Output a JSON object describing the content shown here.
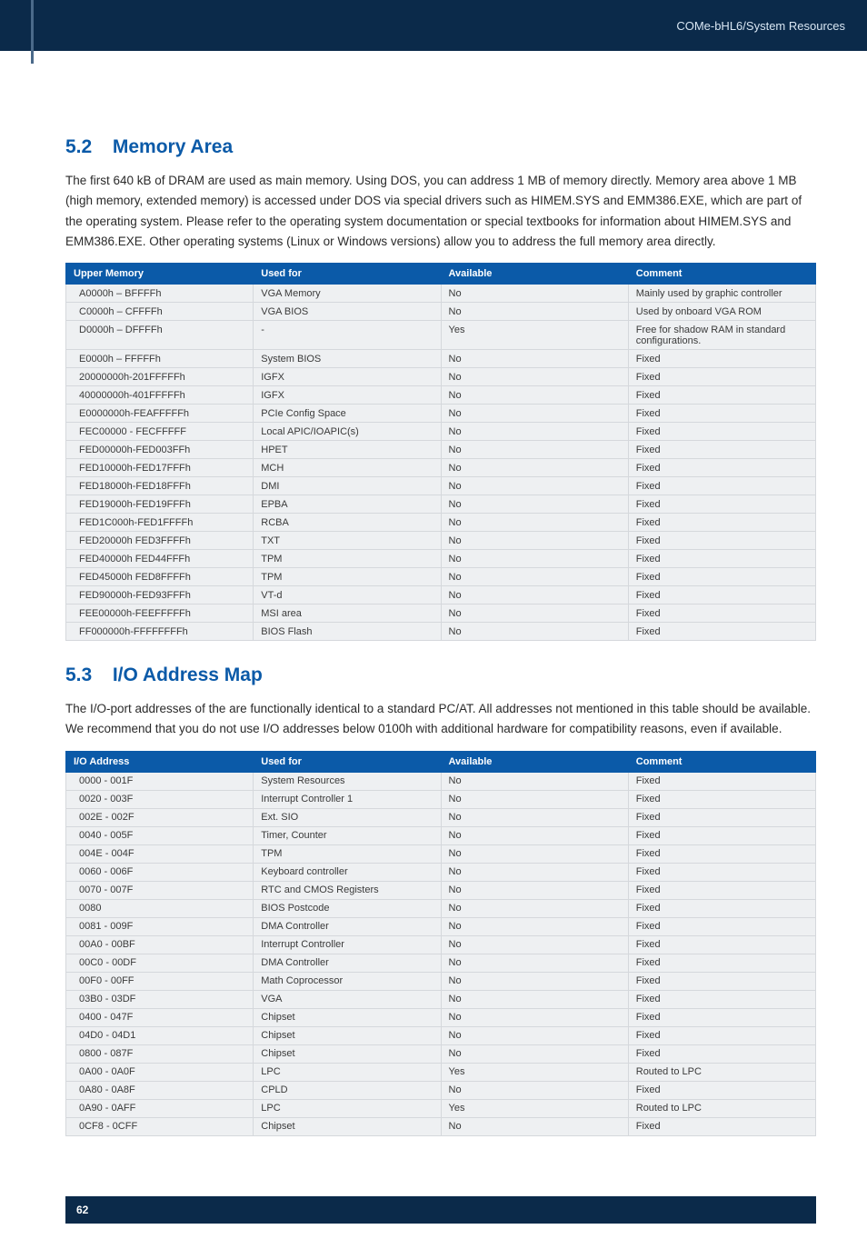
{
  "header": {
    "product": "COMe-bHL6",
    "separator": " / ",
    "section": "System Resources"
  },
  "section52": {
    "number": "5.2",
    "title": "Memory Area",
    "paragraph": "The first 640 kB of DRAM are used as main memory. Using DOS, you can address 1 MB of memory directly. Memory area above 1 MB (high memory, extended memory) is accessed under DOS via special drivers such as HIMEM.SYS and EMM386.EXE, which are part of the operating system. Please refer to the operating system documentation or special textbooks for information about HIMEM.SYS and EMM386.EXE. Other operating systems (Linux or Windows versions) allow you to address the full memory area directly.",
    "table": {
      "headers": [
        "Upper Memory",
        "Used for",
        "Available",
        "Comment"
      ],
      "rows": [
        [
          "A0000h – BFFFFh",
          "VGA Memory",
          "No",
          "Mainly used by graphic controller"
        ],
        [
          "C0000h – CFFFFh",
          "VGA BIOS",
          "No",
          "Used by onboard VGA ROM"
        ],
        [
          "D0000h – DFFFFh",
          "-",
          "Yes",
          "Free for shadow RAM in standard configurations."
        ],
        [
          "E0000h – FFFFFh",
          "System BIOS",
          "No",
          "Fixed"
        ],
        [
          "20000000h-201FFFFFh",
          "IGFX",
          "No",
          "Fixed"
        ],
        [
          "40000000h-401FFFFFh",
          "IGFX",
          "No",
          "Fixed"
        ],
        [
          "E0000000h-FEAFFFFFh",
          "PCIe Config Space",
          "No",
          "Fixed"
        ],
        [
          "FEC00000 - FECFFFFF",
          "Local APIC/IOAPIC(s)",
          "No",
          "Fixed"
        ],
        [
          "FED00000h-FED003FFh",
          "HPET",
          "No",
          "Fixed"
        ],
        [
          "FED10000h-FED17FFFh",
          "MCH",
          "No",
          "Fixed"
        ],
        [
          "FED18000h-FED18FFFh",
          "DMI",
          "No",
          "Fixed"
        ],
        [
          "FED19000h-FED19FFFh",
          "EPBA",
          "No",
          "Fixed"
        ],
        [
          "FED1C000h-FED1FFFFh",
          "RCBA",
          "No",
          "Fixed"
        ],
        [
          "FED20000h FED3FFFFh",
          "TXT",
          "No",
          "Fixed"
        ],
        [
          "FED40000h FED44FFFh",
          "TPM",
          "No",
          "Fixed"
        ],
        [
          "FED45000h FED8FFFFh",
          "TPM",
          "No",
          "Fixed"
        ],
        [
          "FED90000h-FED93FFFh",
          "VT-d",
          "No",
          "Fixed"
        ],
        [
          "FEE00000h-FEEFFFFFh",
          "MSI area",
          "No",
          "Fixed"
        ],
        [
          "FF000000h-FFFFFFFFh",
          "BIOS Flash",
          "No",
          "Fixed"
        ]
      ]
    }
  },
  "section53": {
    "number": "5.3",
    "title": "I/O Address Map",
    "paragraph": "The I/O-port addresses of the are functionally identical to a standard PC/AT. All addresses not mentioned in this table should be available. We recommend that you do not use I/O addresses below 0100h with additional hardware for compatibility reasons, even if available.",
    "table": {
      "headers": [
        "I/O Address",
        "Used for",
        "Available",
        "Comment"
      ],
      "rows": [
        [
          "0000 - 001F",
          "System Resources",
          "No",
          "Fixed"
        ],
        [
          "0020 - 003F",
          "Interrupt Controller 1",
          "No",
          "Fixed"
        ],
        [
          "002E - 002F",
          "Ext. SIO",
          "No",
          "Fixed"
        ],
        [
          "0040 - 005F",
          "Timer, Counter",
          "No",
          "Fixed"
        ],
        [
          "004E - 004F",
          "TPM",
          "No",
          "Fixed"
        ],
        [
          "0060 - 006F",
          "Keyboard controller",
          "No",
          "Fixed"
        ],
        [
          "0070 - 007F",
          "RTC and CMOS Registers",
          "No",
          "Fixed"
        ],
        [
          "0080",
          "BIOS Postcode",
          "No",
          "Fixed"
        ],
        [
          "0081 - 009F",
          "DMA Controller",
          "No",
          "Fixed"
        ],
        [
          "00A0 - 00BF",
          "Interrupt Controller",
          "No",
          "Fixed"
        ],
        [
          "00C0 - 00DF",
          "DMA Controller",
          "No",
          "Fixed"
        ],
        [
          "00F0 - 00FF",
          "Math Coprocessor",
          "No",
          "Fixed"
        ],
        [
          "03B0 - 03DF",
          "VGA",
          "No",
          "Fixed"
        ],
        [
          "0400 - 047F",
          "Chipset",
          "No",
          "Fixed"
        ],
        [
          "04D0 - 04D1",
          "Chipset",
          "No",
          "Fixed"
        ],
        [
          "0800 - 087F",
          "Chipset",
          "No",
          "Fixed"
        ],
        [
          "0A00 - 0A0F",
          "LPC",
          "Yes",
          "Routed to LPC"
        ],
        [
          "0A80 - 0A8F",
          "CPLD",
          "No",
          "Fixed"
        ],
        [
          "0A90 - 0AFF",
          "LPC",
          "Yes",
          "Routed to LPC"
        ],
        [
          "0CF8 - 0CFF",
          "Chipset",
          "No",
          "Fixed"
        ]
      ]
    }
  },
  "footer": {
    "page_number": "62"
  },
  "chart_data": [
    {
      "type": "table",
      "title": "Upper Memory Map",
      "columns": [
        "Upper Memory",
        "Used for",
        "Available",
        "Comment"
      ],
      "rows": [
        [
          "A0000h – BFFFFh",
          "VGA Memory",
          "No",
          "Mainly used by graphic controller"
        ],
        [
          "C0000h – CFFFFh",
          "VGA BIOS",
          "No",
          "Used by onboard VGA ROM"
        ],
        [
          "D0000h – DFFFFh",
          "-",
          "Yes",
          "Free for shadow RAM in standard configurations."
        ],
        [
          "E0000h – FFFFFh",
          "System BIOS",
          "No",
          "Fixed"
        ],
        [
          "20000000h-201FFFFFh",
          "IGFX",
          "No",
          "Fixed"
        ],
        [
          "40000000h-401FFFFFh",
          "IGFX",
          "No",
          "Fixed"
        ],
        [
          "E0000000h-FEAFFFFFh",
          "PCIe Config Space",
          "No",
          "Fixed"
        ],
        [
          "FEC00000 - FECFFFFF",
          "Local APIC/IOAPIC(s)",
          "No",
          "Fixed"
        ],
        [
          "FED00000h-FED003FFh",
          "HPET",
          "No",
          "Fixed"
        ],
        [
          "FED10000h-FED17FFFh",
          "MCH",
          "No",
          "Fixed"
        ],
        [
          "FED18000h-FED18FFFh",
          "DMI",
          "No",
          "Fixed"
        ],
        [
          "FED19000h-FED19FFFh",
          "EPBA",
          "No",
          "Fixed"
        ],
        [
          "FED1C000h-FED1FFFFh",
          "RCBA",
          "No",
          "Fixed"
        ],
        [
          "FED20000h FED3FFFFh",
          "TXT",
          "No",
          "Fixed"
        ],
        [
          "FED40000h FED44FFFh",
          "TPM",
          "No",
          "Fixed"
        ],
        [
          "FED45000h FED8FFFFh",
          "TPM",
          "No",
          "Fixed"
        ],
        [
          "FED90000h-FED93FFFh",
          "VT-d",
          "No",
          "Fixed"
        ],
        [
          "FEE00000h-FEEFFFFFh",
          "MSI area",
          "No",
          "Fixed"
        ],
        [
          "FF000000h-FFFFFFFFh",
          "BIOS Flash",
          "No",
          "Fixed"
        ]
      ]
    },
    {
      "type": "table",
      "title": "I/O Address Map",
      "columns": [
        "I/O Address",
        "Used for",
        "Available",
        "Comment"
      ],
      "rows": [
        [
          "0000 - 001F",
          "System Resources",
          "No",
          "Fixed"
        ],
        [
          "0020 - 003F",
          "Interrupt Controller 1",
          "No",
          "Fixed"
        ],
        [
          "002E - 002F",
          "Ext. SIO",
          "No",
          "Fixed"
        ],
        [
          "0040 - 005F",
          "Timer, Counter",
          "No",
          "Fixed"
        ],
        [
          "004E - 004F",
          "TPM",
          "No",
          "Fixed"
        ],
        [
          "0060 - 006F",
          "Keyboard controller",
          "No",
          "Fixed"
        ],
        [
          "0070 - 007F",
          "RTC and CMOS Registers",
          "No",
          "Fixed"
        ],
        [
          "0080",
          "BIOS Postcode",
          "No",
          "Fixed"
        ],
        [
          "0081 - 009F",
          "DMA Controller",
          "No",
          "Fixed"
        ],
        [
          "00A0 - 00BF",
          "Interrupt Controller",
          "No",
          "Fixed"
        ],
        [
          "00C0 - 00DF",
          "DMA Controller",
          "No",
          "Fixed"
        ],
        [
          "00F0 - 00FF",
          "Math Coprocessor",
          "No",
          "Fixed"
        ],
        [
          "03B0 - 03DF",
          "VGA",
          "No",
          "Fixed"
        ],
        [
          "0400 - 047F",
          "Chipset",
          "No",
          "Fixed"
        ],
        [
          "04D0 - 04D1",
          "Chipset",
          "No",
          "Fixed"
        ],
        [
          "0800 - 087F",
          "Chipset",
          "No",
          "Fixed"
        ],
        [
          "0A00 - 0A0F",
          "LPC",
          "Yes",
          "Routed to LPC"
        ],
        [
          "0A80 - 0A8F",
          "CPLD",
          "No",
          "Fixed"
        ],
        [
          "0A90 - 0AFF",
          "LPC",
          "Yes",
          "Routed to LPC"
        ],
        [
          "0CF8 - 0CFF",
          "Chipset",
          "No",
          "Fixed"
        ]
      ]
    }
  ]
}
